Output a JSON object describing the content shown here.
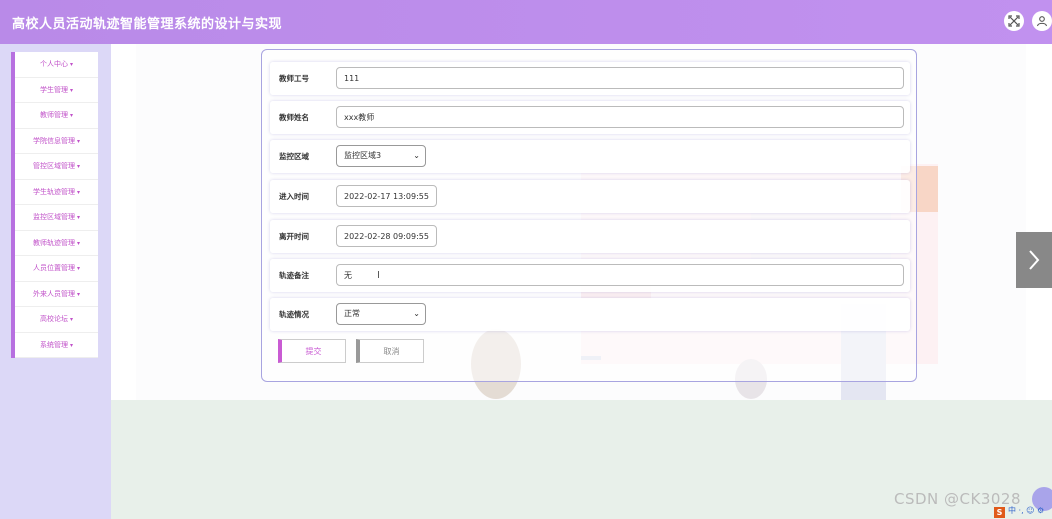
{
  "header": {
    "title": "高校人员活动轨迹智能管理系统的设计与实现",
    "icons": [
      "fullscreen-icon",
      "user-icon"
    ]
  },
  "sidebar": {
    "items": [
      {
        "label": "个人中心"
      },
      {
        "label": "学生管理"
      },
      {
        "label": "教师管理"
      },
      {
        "label": "学院信息管理"
      },
      {
        "label": "管控区域管理"
      },
      {
        "label": "学生轨迹管理"
      },
      {
        "label": "监控区域管理"
      },
      {
        "label": "教师轨迹管理"
      },
      {
        "label": "人员位置管理"
      },
      {
        "label": "外来人员管理"
      },
      {
        "label": "高校论坛"
      },
      {
        "label": "系统管理"
      }
    ],
    "caret": "▾"
  },
  "form": {
    "teacher_id": {
      "label": "教师工号",
      "value": "111"
    },
    "teacher_name": {
      "label": "教师姓名",
      "value": "xxx教师"
    },
    "monitor_area": {
      "label": "监控区域",
      "value": "监控区域3"
    },
    "enter_time": {
      "label": "进入时间",
      "value": "2022-02-17 13:09:55"
    },
    "leave_time": {
      "label": "离开时间",
      "value": "2022-02-28 09:09:55"
    },
    "track_note": {
      "label": "轨迹备注",
      "value": "无"
    },
    "track_status": {
      "label": "轨迹情况",
      "value": "正常"
    },
    "submit_label": "提交",
    "cancel_label": "取消"
  },
  "watermark": "CSDN @CK3028",
  "ime": {
    "s": "S",
    "text": "中 ·, ☺ ⚙"
  },
  "colors": {
    "header": "#c191ef",
    "accent": "#c95bd3",
    "sidebar_bg": "#dcd8f7",
    "form_border": "#a8a4e0"
  }
}
